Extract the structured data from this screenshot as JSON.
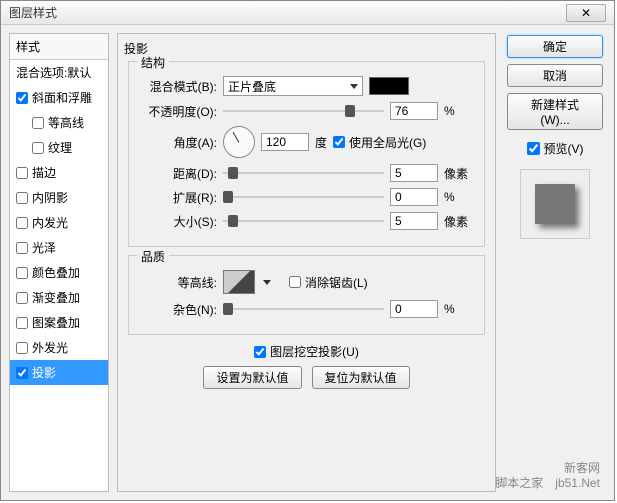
{
  "dialog": {
    "title": "图层样式",
    "close": "✕"
  },
  "left": {
    "header": "样式",
    "items": [
      {
        "label": "混合选项:默认",
        "cb": false
      },
      {
        "label": "斜面和浮雕",
        "cb": true,
        "checked": true
      },
      {
        "label": "等高线",
        "cb": true,
        "checked": false,
        "indent": true
      },
      {
        "label": "纹理",
        "cb": true,
        "checked": false,
        "indent": true
      },
      {
        "label": "描边",
        "cb": true,
        "checked": false
      },
      {
        "label": "内阴影",
        "cb": true,
        "checked": false
      },
      {
        "label": "内发光",
        "cb": true,
        "checked": false
      },
      {
        "label": "光泽",
        "cb": true,
        "checked": false
      },
      {
        "label": "颜色叠加",
        "cb": true,
        "checked": false
      },
      {
        "label": "渐变叠加",
        "cb": true,
        "checked": false
      },
      {
        "label": "图案叠加",
        "cb": true,
        "checked": false
      },
      {
        "label": "外发光",
        "cb": true,
        "checked": false
      },
      {
        "label": "投影",
        "cb": true,
        "checked": true,
        "selected": true
      }
    ]
  },
  "center": {
    "title": "投影",
    "group1": {
      "title": "结构",
      "blend_mode_label": "混合模式(B):",
      "blend_mode_value": "正片叠底",
      "opacity_label": "不透明度(O):",
      "opacity_value": "76",
      "opacity_unit": "%",
      "angle_label": "角度(A):",
      "angle_value": "120",
      "angle_unit": "度",
      "global_light_label": "使用全局光(G)",
      "global_light_checked": true,
      "distance_label": "距离(D):",
      "distance_value": "5",
      "distance_unit": "像素",
      "spread_label": "扩展(R):",
      "spread_value": "0",
      "spread_unit": "%",
      "size_label": "大小(S):",
      "size_value": "5",
      "size_unit": "像素"
    },
    "group2": {
      "title": "品质",
      "contour_label": "等高线:",
      "anti_alias_label": "消除锯齿(L)",
      "anti_alias_checked": false,
      "noise_label": "杂色(N):",
      "noise_value": "0",
      "noise_unit": "%"
    },
    "knockout_label": "图层挖空投影(U)",
    "knockout_checked": true,
    "btn_default": "设置为默认值",
    "btn_reset": "复位为默认值"
  },
  "right": {
    "ok": "确定",
    "cancel": "取消",
    "new_style": "新建样式(W)...",
    "preview_label": "预览(V)",
    "preview_checked": true
  },
  "watermark": {
    "line1": "新客网",
    "line2": "脚本之家　jb51.Net"
  }
}
